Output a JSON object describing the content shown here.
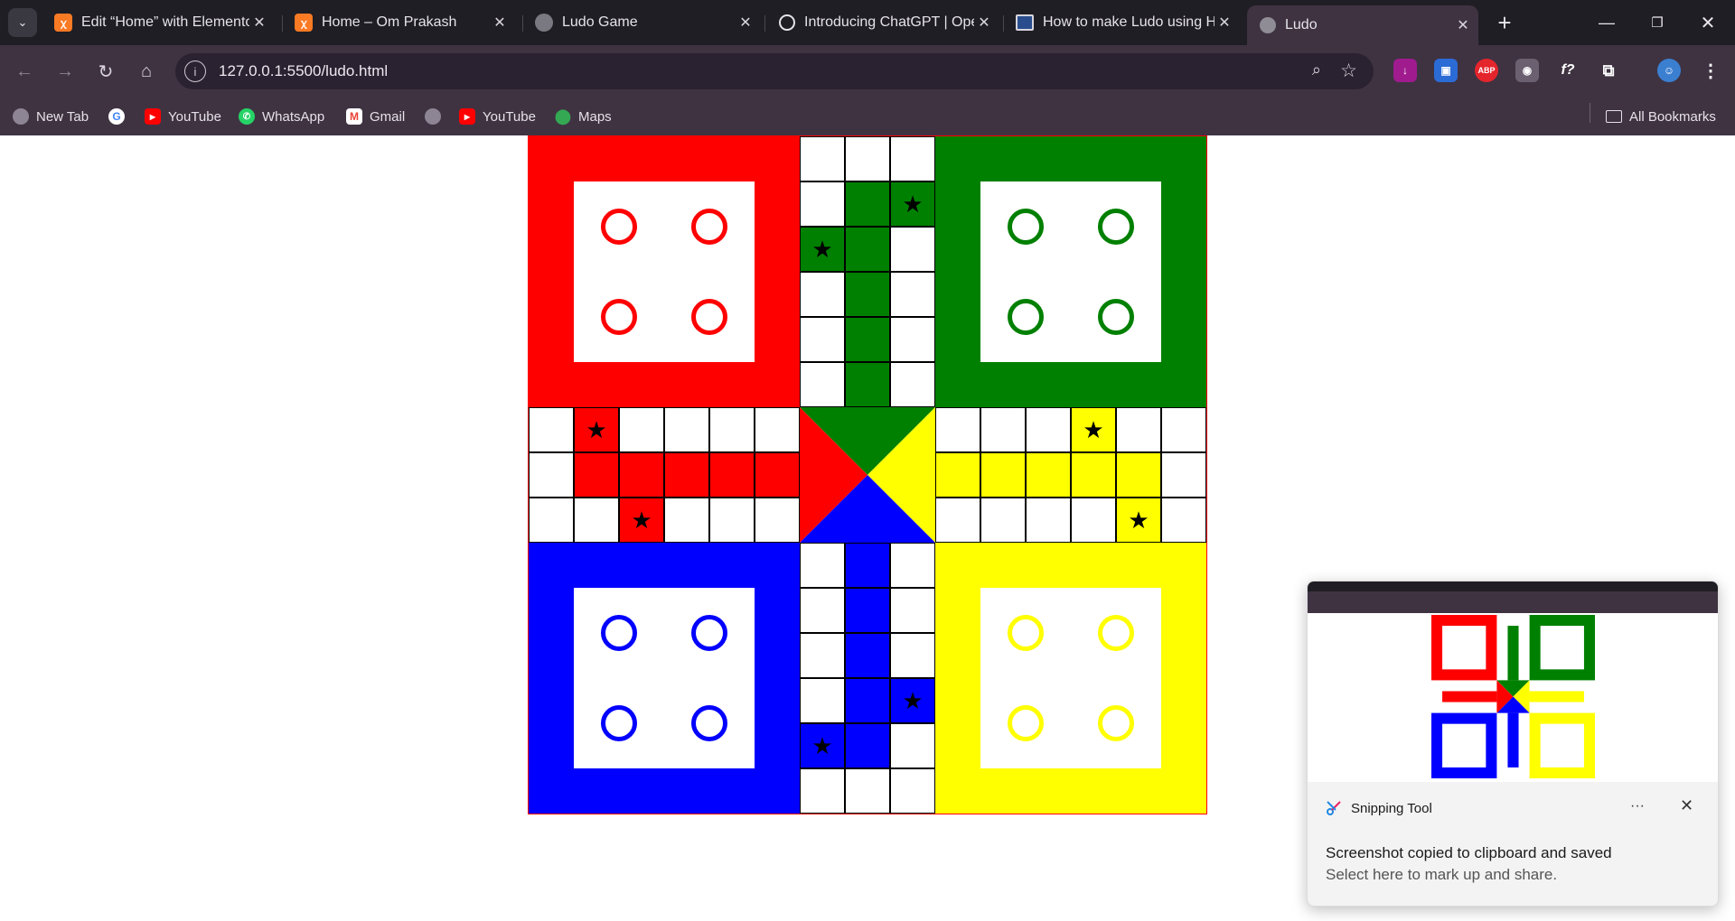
{
  "browser": {
    "tabs": [
      {
        "title": "Edit “Home” with Elementor",
        "favicon": "xampp-icon",
        "active": false
      },
      {
        "title": "Home – Om Prakash",
        "favicon": "xampp-icon",
        "active": false
      },
      {
        "title": "Ludo Game",
        "favicon": "globe-icon",
        "active": false
      },
      {
        "title": "Introducing ChatGPT | OpenAI",
        "favicon": "openai-icon",
        "active": false
      },
      {
        "title": "How to make Ludo using HTML",
        "favicon": "image-icon",
        "active": false
      },
      {
        "title": "Ludo",
        "favicon": "globe-icon",
        "active": true
      }
    ],
    "address": "127.0.0.1:5500/ludo.html",
    "bookmarks": [
      {
        "label": "New Tab",
        "icon": "globe-icon"
      },
      {
        "label": "",
        "icon": "google-icon"
      },
      {
        "label": "YouTube",
        "icon": "youtube-icon"
      },
      {
        "label": "WhatsApp",
        "icon": "whatsapp-icon"
      },
      {
        "label": "Gmail",
        "icon": "gmail-icon"
      },
      {
        "label": "",
        "icon": "globe-icon"
      },
      {
        "label": "YouTube",
        "icon": "youtube-icon"
      },
      {
        "label": "Maps",
        "icon": "maps-icon"
      }
    ],
    "all_bookmarks": "All Bookmarks",
    "extensions": [
      "download-extension-icon",
      "docs-extension-icon",
      "adblock-plus-icon",
      "camera-extension-icon",
      "formula-extension-icon",
      "puzzle-icon"
    ],
    "extension_labels": {
      "adblock": "ABP",
      "formula": "f?"
    }
  },
  "board": {
    "colors": {
      "red": "#ff0000",
      "green": "#008000",
      "yellow": "#ffff00",
      "blue": "#0000ff",
      "border": "#ff0000"
    },
    "star_symbol": "★",
    "homes": [
      "red",
      "green",
      "blue",
      "yellow"
    ],
    "tokens_per_home": 4
  },
  "notification": {
    "app": "Snipping Tool",
    "title": "Screenshot copied to clipboard and saved",
    "body": "Select here to mark up and share.",
    "more": "···",
    "close": "✕"
  }
}
